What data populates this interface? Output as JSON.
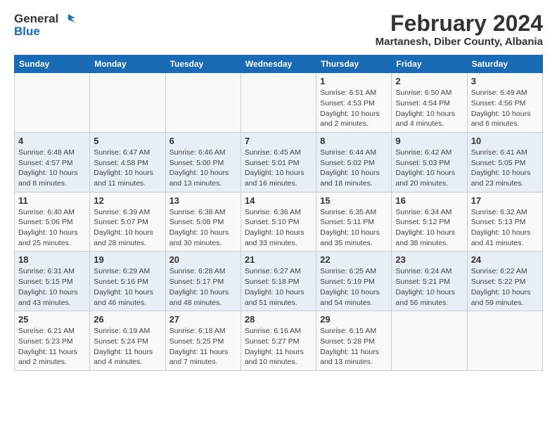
{
  "logo": {
    "general": "General",
    "blue": "Blue"
  },
  "title": "February 2024",
  "subtitle": "Martanesh, Diber County, Albania",
  "days_header": [
    "Sunday",
    "Monday",
    "Tuesday",
    "Wednesday",
    "Thursday",
    "Friday",
    "Saturday"
  ],
  "weeks": [
    [
      {
        "day": "",
        "info": ""
      },
      {
        "day": "",
        "info": ""
      },
      {
        "day": "",
        "info": ""
      },
      {
        "day": "",
        "info": ""
      },
      {
        "day": "1",
        "info": "Sunrise: 6:51 AM\nSunset: 4:53 PM\nDaylight: 10 hours\nand 2 minutes."
      },
      {
        "day": "2",
        "info": "Sunrise: 6:50 AM\nSunset: 4:54 PM\nDaylight: 10 hours\nand 4 minutes."
      },
      {
        "day": "3",
        "info": "Sunrise: 6:49 AM\nSunset: 4:56 PM\nDaylight: 10 hours\nand 6 minutes."
      }
    ],
    [
      {
        "day": "4",
        "info": "Sunrise: 6:48 AM\nSunset: 4:57 PM\nDaylight: 10 hours\nand 8 minutes."
      },
      {
        "day": "5",
        "info": "Sunrise: 6:47 AM\nSunset: 4:58 PM\nDaylight: 10 hours\nand 11 minutes."
      },
      {
        "day": "6",
        "info": "Sunrise: 6:46 AM\nSunset: 5:00 PM\nDaylight: 10 hours\nand 13 minutes."
      },
      {
        "day": "7",
        "info": "Sunrise: 6:45 AM\nSunset: 5:01 PM\nDaylight: 10 hours\nand 16 minutes."
      },
      {
        "day": "8",
        "info": "Sunrise: 6:44 AM\nSunset: 5:02 PM\nDaylight: 10 hours\nand 18 minutes."
      },
      {
        "day": "9",
        "info": "Sunrise: 6:42 AM\nSunset: 5:03 PM\nDaylight: 10 hours\nand 20 minutes."
      },
      {
        "day": "10",
        "info": "Sunrise: 6:41 AM\nSunset: 5:05 PM\nDaylight: 10 hours\nand 23 minutes."
      }
    ],
    [
      {
        "day": "11",
        "info": "Sunrise: 6:40 AM\nSunset: 5:06 PM\nDaylight: 10 hours\nand 25 minutes."
      },
      {
        "day": "12",
        "info": "Sunrise: 6:39 AM\nSunset: 5:07 PM\nDaylight: 10 hours\nand 28 minutes."
      },
      {
        "day": "13",
        "info": "Sunrise: 6:38 AM\nSunset: 5:08 PM\nDaylight: 10 hours\nand 30 minutes."
      },
      {
        "day": "14",
        "info": "Sunrise: 6:36 AM\nSunset: 5:10 PM\nDaylight: 10 hours\nand 33 minutes."
      },
      {
        "day": "15",
        "info": "Sunrise: 6:35 AM\nSunset: 5:11 PM\nDaylight: 10 hours\nand 35 minutes."
      },
      {
        "day": "16",
        "info": "Sunrise: 6:34 AM\nSunset: 5:12 PM\nDaylight: 10 hours\nand 38 minutes."
      },
      {
        "day": "17",
        "info": "Sunrise: 6:32 AM\nSunset: 5:13 PM\nDaylight: 10 hours\nand 41 minutes."
      }
    ],
    [
      {
        "day": "18",
        "info": "Sunrise: 6:31 AM\nSunset: 5:15 PM\nDaylight: 10 hours\nand 43 minutes."
      },
      {
        "day": "19",
        "info": "Sunrise: 6:29 AM\nSunset: 5:16 PM\nDaylight: 10 hours\nand 46 minutes."
      },
      {
        "day": "20",
        "info": "Sunrise: 6:28 AM\nSunset: 5:17 PM\nDaylight: 10 hours\nand 48 minutes."
      },
      {
        "day": "21",
        "info": "Sunrise: 6:27 AM\nSunset: 5:18 PM\nDaylight: 10 hours\nand 51 minutes."
      },
      {
        "day": "22",
        "info": "Sunrise: 6:25 AM\nSunset: 5:19 PM\nDaylight: 10 hours\nand 54 minutes."
      },
      {
        "day": "23",
        "info": "Sunrise: 6:24 AM\nSunset: 5:21 PM\nDaylight: 10 hours\nand 56 minutes."
      },
      {
        "day": "24",
        "info": "Sunrise: 6:22 AM\nSunset: 5:22 PM\nDaylight: 10 hours\nand 59 minutes."
      }
    ],
    [
      {
        "day": "25",
        "info": "Sunrise: 6:21 AM\nSunset: 5:23 PM\nDaylight: 11 hours\nand 2 minutes."
      },
      {
        "day": "26",
        "info": "Sunrise: 6:19 AM\nSunset: 5:24 PM\nDaylight: 11 hours\nand 4 minutes."
      },
      {
        "day": "27",
        "info": "Sunrise: 6:18 AM\nSunset: 5:25 PM\nDaylight: 11 hours\nand 7 minutes."
      },
      {
        "day": "28",
        "info": "Sunrise: 6:16 AM\nSunset: 5:27 PM\nDaylight: 11 hours\nand 10 minutes."
      },
      {
        "day": "29",
        "info": "Sunrise: 6:15 AM\nSunset: 5:28 PM\nDaylight: 11 hours\nand 13 minutes."
      },
      {
        "day": "",
        "info": ""
      },
      {
        "day": "",
        "info": ""
      }
    ]
  ]
}
